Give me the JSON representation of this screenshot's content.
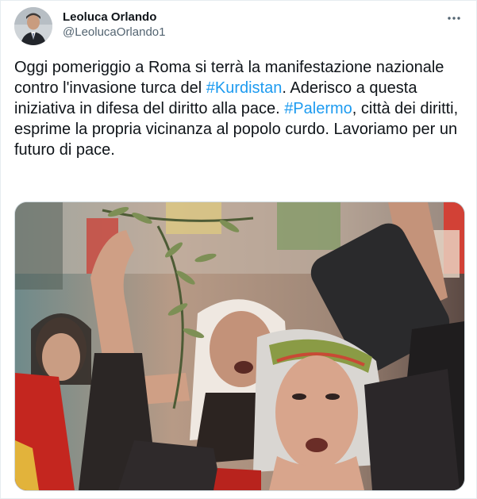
{
  "tweet": {
    "author": {
      "name": "Leoluca Orlando",
      "handle": "@LeolucaOrlando1"
    },
    "more_label": "More",
    "text_parts": {
      "p1": "Oggi pomeriggio a Roma si terrà la manifestazione nazionale contro l'invasione turca del ",
      "h1": "#Kurdistan",
      "p2": ". Aderisco a questa iniziativa in difesa del diritto alla pace. ",
      "h2": "#Palermo",
      "p3": ", città dei diritti, esprime la propria vicinanza al popolo curdo. Lavoriamo per un futuro di pace."
    },
    "colors": {
      "text": "#0f1419",
      "secondary": "#536471",
      "link": "#1d9bf0",
      "border": "#cfd9de"
    },
    "icons": {
      "more": "more-horizontal-icon"
    }
  }
}
